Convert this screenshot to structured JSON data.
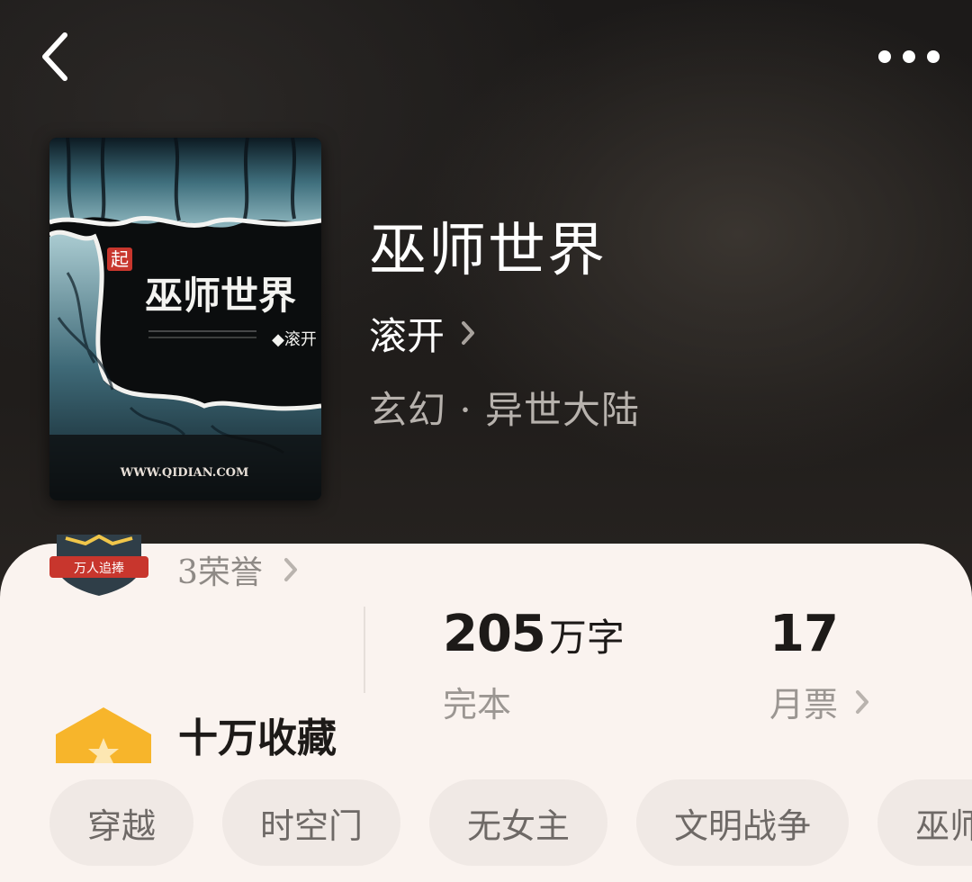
{
  "book": {
    "title": "巫师世界",
    "author": "滚开",
    "genre": "玄幻 · 异世大陆",
    "cover": {
      "title_text": "巫师世界",
      "author_text": "◆滚开",
      "site_text": "WWW.QIDIAN.COM",
      "logo_text": "起"
    }
  },
  "honor": {
    "badge_text": "万人追捧",
    "text": "3荣誉"
  },
  "stats": {
    "words": {
      "value": "205",
      "unit": "万字",
      "label": "完本"
    },
    "votes": {
      "value": "17",
      "label": "月票"
    }
  },
  "collection": {
    "text": "十万收藏"
  },
  "tags": [
    "穿越",
    "时空门",
    "无女主",
    "文明战争",
    "巫师"
  ],
  "colors": {
    "card_bg": "#faf3ef",
    "tag_bg": "#f0e9e5",
    "collect_icon": "#f7b52b",
    "badge_red": "#c8362d"
  },
  "icons": {
    "back": "chevron-left-icon",
    "more": "more-dots-icon",
    "chevron": "chevron-right-icon"
  }
}
